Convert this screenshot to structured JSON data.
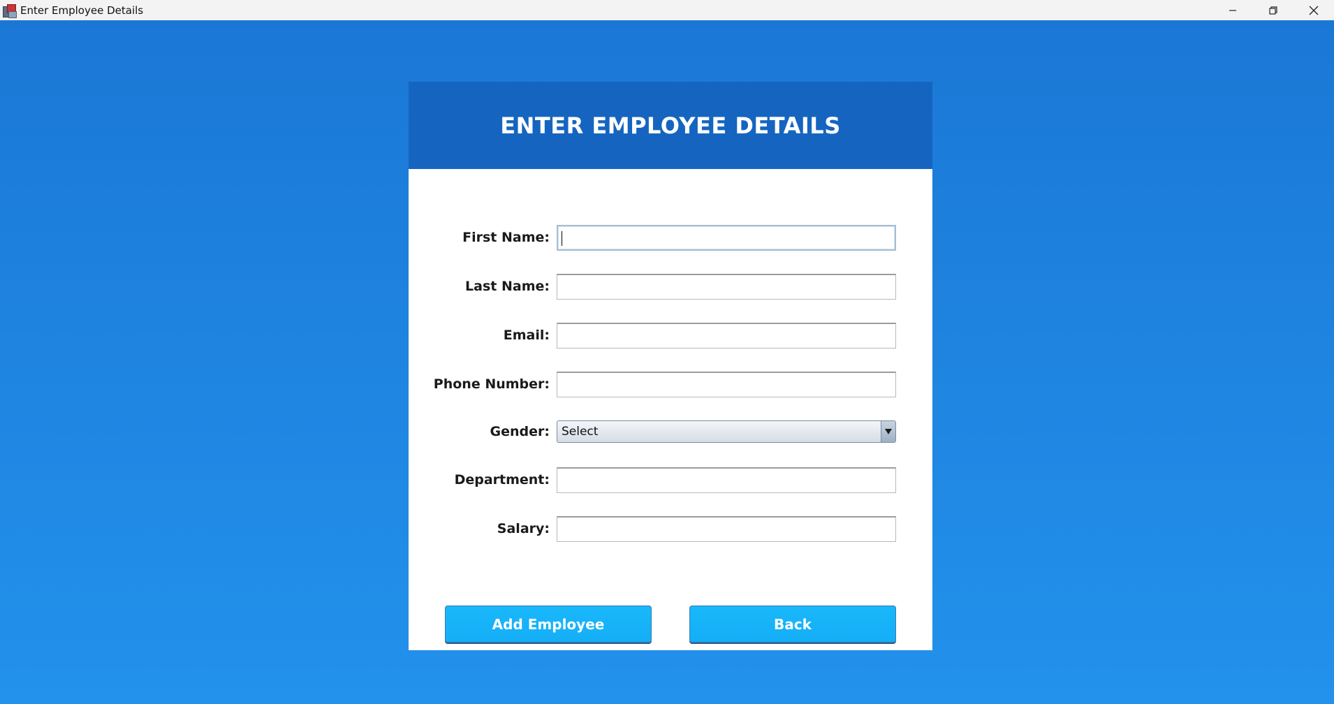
{
  "window": {
    "title": "Enter Employee Details",
    "controls": [
      "minimize",
      "restore",
      "close"
    ]
  },
  "card": {
    "heading": "ENTER EMPLOYEE DETAILS"
  },
  "form": {
    "first_name": {
      "label": "First Name:",
      "value": ""
    },
    "last_name": {
      "label": "Last Name:",
      "value": ""
    },
    "email": {
      "label": "Email:",
      "value": ""
    },
    "phone": {
      "label": "Phone Number:",
      "value": ""
    },
    "gender": {
      "label": "Gender:",
      "selected": "Select"
    },
    "department": {
      "label": "Department:",
      "value": ""
    },
    "salary": {
      "label": "Salary:",
      "value": ""
    }
  },
  "buttons": {
    "add": "Add Employee",
    "back": "Back"
  },
  "colors": {
    "background_top": "#1b77d5",
    "background_bottom": "#2292ec",
    "header": "#1565c0",
    "button": "#18b4fa"
  },
  "icons": {
    "app": "app-icon",
    "minimize": "minimize-icon",
    "restore": "restore-icon",
    "close": "close-icon",
    "dropdown": "dropdown-arrow-icon"
  }
}
